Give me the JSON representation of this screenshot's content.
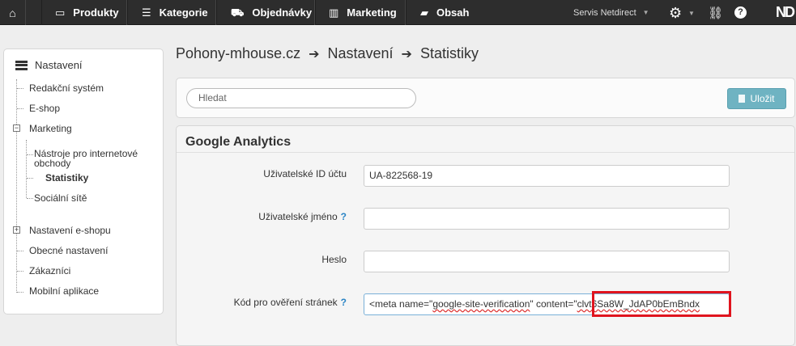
{
  "topnav": {
    "items": [
      {
        "label": "Produkty",
        "icon": "monitor-icon"
      },
      {
        "label": "Kategorie",
        "icon": "list-icon"
      },
      {
        "label": "Objednávky",
        "icon": "cart-icon"
      },
      {
        "label": "Marketing",
        "icon": "chart-icon"
      },
      {
        "label": "Obsah",
        "icon": "book-icon"
      }
    ],
    "account": "Servis Netdirect",
    "logo": "ND"
  },
  "sidebar": {
    "title": "Nastavení",
    "items": [
      {
        "label": "Redakční systém"
      },
      {
        "label": "E-shop"
      },
      {
        "label": "Marketing"
      },
      {
        "label": "Nástroje pro internetové obchody"
      },
      {
        "label": "Statistiky"
      },
      {
        "label": "Sociální sítě"
      },
      {
        "label": "Nastavení e-shopu"
      },
      {
        "label": "Obecné nastavení"
      },
      {
        "label": "Zákazníci"
      },
      {
        "label": "Mobilní aplikace"
      }
    ]
  },
  "breadcrumb": {
    "site": "Pohony-mhouse.cz",
    "section": "Nastavení",
    "page": "Statistiky",
    "separator": "➔"
  },
  "toolbar": {
    "search_placeholder": "Hledat",
    "save_label": "Uložit"
  },
  "google_analytics": {
    "title": "Google Analytics",
    "fields": [
      {
        "label": "Uživatelské ID účtu",
        "value": "UA-822568-19",
        "help": ""
      },
      {
        "label": "Uživatelské jméno",
        "value": "",
        "help": "?"
      },
      {
        "label": "Heslo",
        "value": "",
        "help": ""
      },
      {
        "label": "Kód pro ověření stránek",
        "help": "?",
        "value_parts": [
          "<meta name=\"",
          "google-site-verification",
          "\" content=\"",
          "clvt6Sa8W_JdAP0bEmBndx"
        ]
      }
    ]
  },
  "colors": {
    "topbar": "#2d2d2d",
    "save_button": "#6fb3c2",
    "help_icon": "#2a84c5",
    "highlight": "#e0141e"
  }
}
